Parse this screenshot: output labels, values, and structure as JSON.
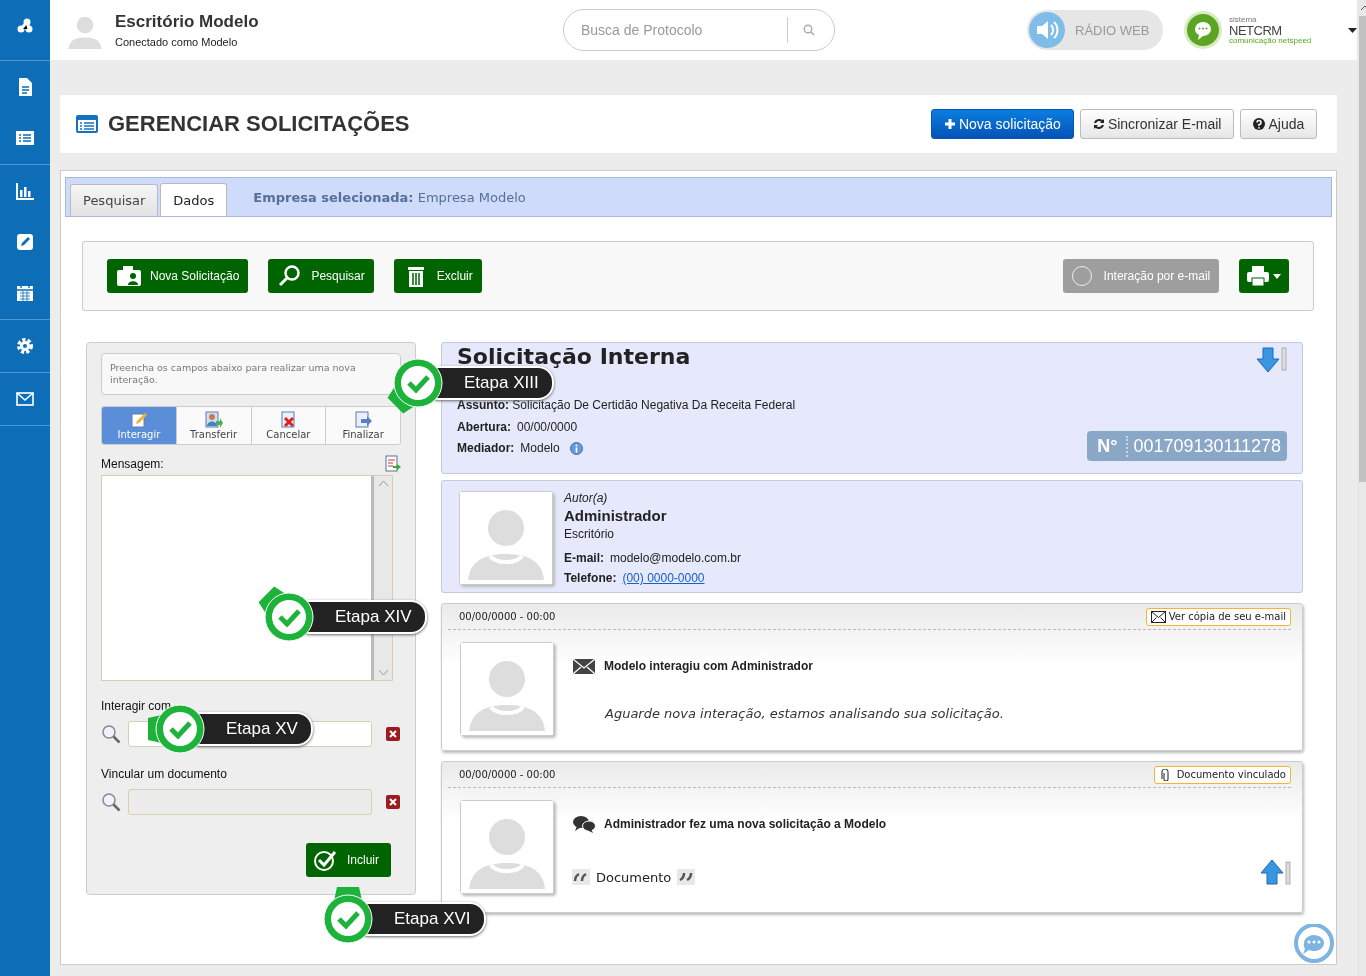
{
  "header": {
    "title": "Escritório Modelo",
    "subtitle": "Conectado como Modelo",
    "search_placeholder": "Busca de Protocolo",
    "radio": "RÁDIO WEB",
    "radio_on": false,
    "logo_small": "sistema",
    "logo": "NETCRM",
    "logo_tagline": "comunicação netspeed"
  },
  "page": {
    "title": "GERENCIAR SOLICITAÇÕES",
    "buttons": [
      {
        "label": "Nova solicitação",
        "kind": "new"
      },
      {
        "label": "Sincronizar E-mail",
        "kind": "sync"
      },
      {
        "label": "Ajuda",
        "kind": "help"
      }
    ]
  },
  "tabs": [
    {
      "label": "Pesquisar",
      "selected": false
    },
    {
      "label": "Dados",
      "selected": true
    }
  ],
  "company": {
    "label": "Empresa selecionada:",
    "value": "Empresa Modelo"
  },
  "toolbar": {
    "buttons": [
      {
        "label": "Nova Solicitação",
        "kind": "new"
      },
      {
        "label": "Pesquisar",
        "kind": "search"
      },
      {
        "label": "Excluir",
        "kind": "delete"
      }
    ],
    "email_toggle": {
      "label": "Interação por e-mail",
      "on": false
    }
  },
  "form": {
    "hint": "Preencha os campos abaixo para realizar uma nova interação.",
    "actions": [
      {
        "label": "Interagir",
        "kind": "edit",
        "selected": true
      },
      {
        "label": "Transferir",
        "kind": "transfer",
        "selected": false
      },
      {
        "label": "Cancelar",
        "kind": "cancel",
        "selected": false
      },
      {
        "label": "Finalizar",
        "kind": "finish",
        "selected": false
      }
    ],
    "message_label": "Mensagem:",
    "interact_label": "Interagir com",
    "link_label": "Vincular um documento",
    "submit": "Incluir"
  },
  "request": {
    "title": "Solicitação Interna",
    "subject_label": "Assunto:",
    "subject": "Solicitação De Certidão Negativa Da Receita Federal",
    "opening_label": "Abertura:",
    "opening": "00/00/0000",
    "mediator_label": "Mediador:",
    "mediator": "Modelo",
    "number_label": "N°",
    "number": "001709130111278"
  },
  "author": {
    "role": "Autor(a)",
    "name": "Administrador",
    "org": "Escritório",
    "email_label": "E-mail:",
    "email": "modelo@modelo.com.br",
    "phone_label": "Telefone:",
    "phone": "(00) 0000-0000"
  },
  "interactions": [
    {
      "kind": "email",
      "datetime": "00/00/0000 - 00:00",
      "tag": "Ver cópia de seu e-mail",
      "title": "Modelo interagiu com Administrador",
      "body": "Aguarde nova interação, estamos analisando sua solicitação."
    },
    {
      "kind": "chat",
      "datetime": "00/00/0000 - 00:00",
      "tag": "Documento vinculado",
      "title": "Administrador fez uma nova solicitação a Modelo",
      "body": "Documento"
    }
  ],
  "steps": [
    {
      "label": "Etapa XIII"
    },
    {
      "label": "Etapa XIV"
    },
    {
      "label": "Etapa XV"
    },
    {
      "label": "Etapa XVI"
    }
  ]
}
